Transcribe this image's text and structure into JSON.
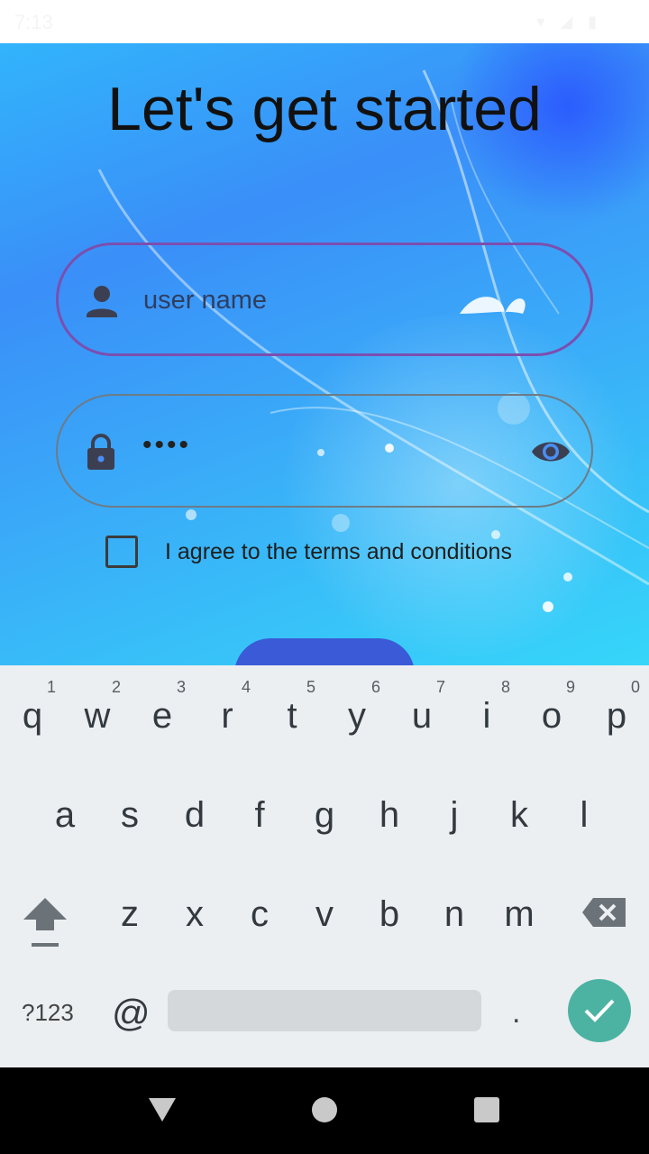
{
  "status_bar": {
    "time": "7:13",
    "icons": "▾ ◢ ▮"
  },
  "page": {
    "title": "Let's get started",
    "username_field": {
      "value": "user name",
      "icon": "person-icon"
    },
    "password_field": {
      "value": "••••",
      "icon": "lock-icon",
      "toggle_icon": "eye-icon"
    },
    "terms": {
      "label": "I agree to the terms and conditions",
      "checked": false
    }
  },
  "keyboard": {
    "row1": [
      {
        "ch": "q",
        "hint": "1"
      },
      {
        "ch": "w",
        "hint": "2"
      },
      {
        "ch": "e",
        "hint": "3"
      },
      {
        "ch": "r",
        "hint": "4"
      },
      {
        "ch": "t",
        "hint": "5"
      },
      {
        "ch": "y",
        "hint": "6"
      },
      {
        "ch": "u",
        "hint": "7"
      },
      {
        "ch": "i",
        "hint": "8"
      },
      {
        "ch": "o",
        "hint": "9"
      },
      {
        "ch": "p",
        "hint": "0"
      }
    ],
    "row2": [
      "a",
      "s",
      "d",
      "f",
      "g",
      "h",
      "j",
      "k",
      "l"
    ],
    "row3": [
      "z",
      "x",
      "c",
      "v",
      "b",
      "n",
      "m"
    ],
    "symbols_label": "?123",
    "at_label": "@",
    "period_label": ".",
    "enter_icon": "check-icon",
    "accent_color": "#4cb3a3"
  },
  "navbar": {
    "back_icon": "back-triangle-icon",
    "home_icon": "home-circle-icon",
    "recents_icon": "recents-square-icon"
  }
}
